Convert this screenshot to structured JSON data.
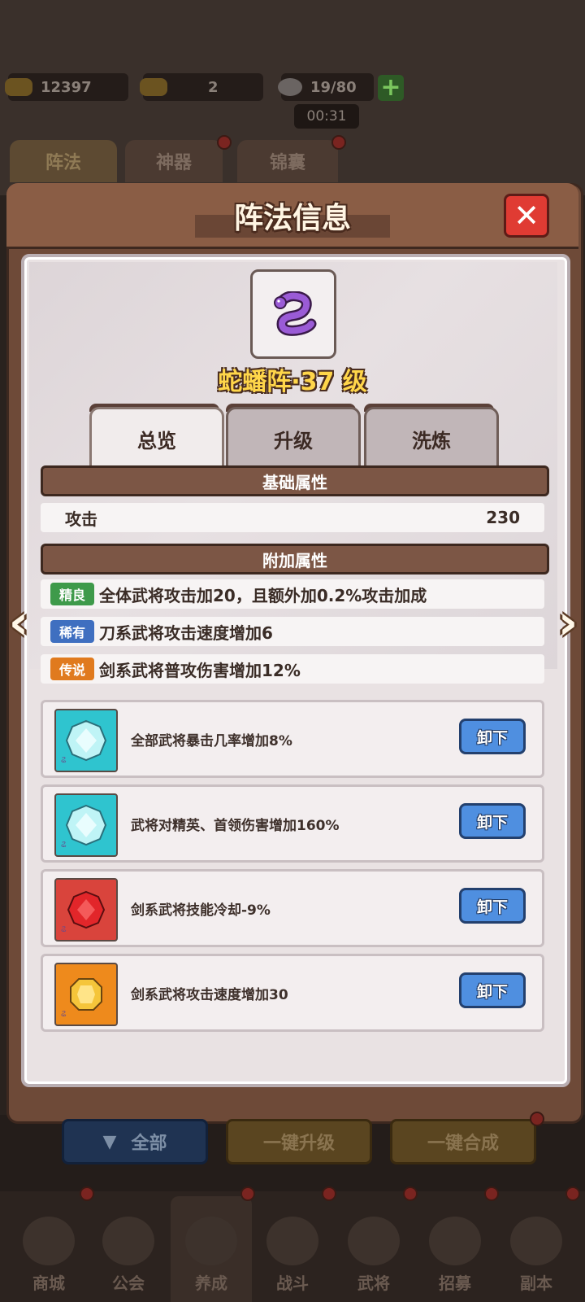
{
  "resources": {
    "gold": "12397",
    "ticket": "2",
    "stamina": "19/80",
    "timer": "00:31"
  },
  "bg_tabs": [
    "阵法",
    "神器",
    "锦囊"
  ],
  "panel": {
    "title": "阵法信息",
    "close": "✕"
  },
  "formation": {
    "name": "蛇蟠阵·37 级",
    "icon": "purple-snake-icon"
  },
  "tabs": [
    "总览",
    "升级",
    "洗炼"
  ],
  "base_section": {
    "title": "基础属性",
    "attack_label": "攻击",
    "attack_value": "230"
  },
  "extra_section": {
    "title": "附加属性",
    "items": [
      {
        "badge": "精良",
        "color": "#3e9a4a",
        "text": "全体武将攻击加20，且额外加0.2%攻击加成"
      },
      {
        "badge": "稀有",
        "color": "#3f6fc0",
        "text": "刀系武将攻击速度增加6"
      },
      {
        "badge": "传说",
        "color": "#e07a1e",
        "text": "剑系武将普攻伤害增加12%"
      }
    ]
  },
  "gems": [
    {
      "icon": "cyan-diamond-icon",
      "bg": "#2fc4cf",
      "text": "全部武将暴击几率增加8%",
      "button": "卸下"
    },
    {
      "icon": "cyan-diamond-icon",
      "bg": "#2fc4cf",
      "text": "武将对精英、首领伤害增加160%",
      "button": "卸下"
    },
    {
      "icon": "red-ruby-icon",
      "bg": "#d9443c",
      "text": "剑系武将技能冷却-9%",
      "button": "卸下"
    },
    {
      "icon": "gold-topaz-icon",
      "bg": "#ee8a1c",
      "text": "剑系武将攻击速度增加30",
      "button": "卸下"
    }
  ],
  "bottom_buttons": {
    "all": "全部",
    "upgrade_all": "一键升级",
    "merge_all": "一键合成"
  },
  "nav": [
    "商城",
    "公会",
    "养成",
    "战斗",
    "武将",
    "招募",
    "副本"
  ]
}
